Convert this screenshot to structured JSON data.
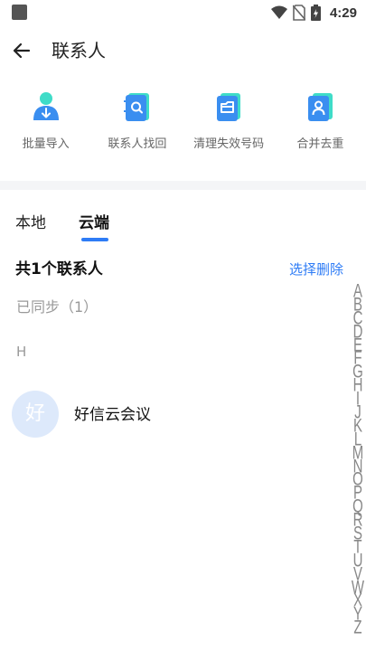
{
  "status_bar": {
    "time": "4:29",
    "icons": [
      "app-square-icon",
      "wifi-icon",
      "no-sim-icon",
      "battery-icon"
    ]
  },
  "header": {
    "title": "联系人"
  },
  "quick_actions": [
    {
      "label": "批量导入",
      "icon": "import-user-icon"
    },
    {
      "label": "联系人找回",
      "icon": "contact-book-search-icon"
    },
    {
      "label": "清理失效号码",
      "icon": "cleanup-folder-icon"
    },
    {
      "label": "合并去重",
      "icon": "merge-contact-icon"
    }
  ],
  "tabs": {
    "local": "本地",
    "cloud": "云端",
    "active": "cloud"
  },
  "summary": "共1个联系人",
  "select_delete": "选择删除",
  "synced_section": "已同步（1）",
  "group_letter": "H",
  "contacts": [
    {
      "avatar_text": "好",
      "name": "好信云会议"
    }
  ],
  "alphabet_index": [
    "A",
    "B",
    "C",
    "D",
    "E",
    "F",
    "G",
    "H",
    "I",
    "J",
    "K",
    "L",
    "M",
    "N",
    "O",
    "P",
    "Q",
    "R",
    "S",
    "T",
    "U",
    "V",
    "W",
    "X",
    "Y",
    "Z"
  ],
  "colors": {
    "accent": "#2e7cf6",
    "icon_blue": "#3a8ef0",
    "icon_teal": "#3fdcc8",
    "avatar_bg": "#dde9fb",
    "divider_bg": "#f4f5f7"
  }
}
